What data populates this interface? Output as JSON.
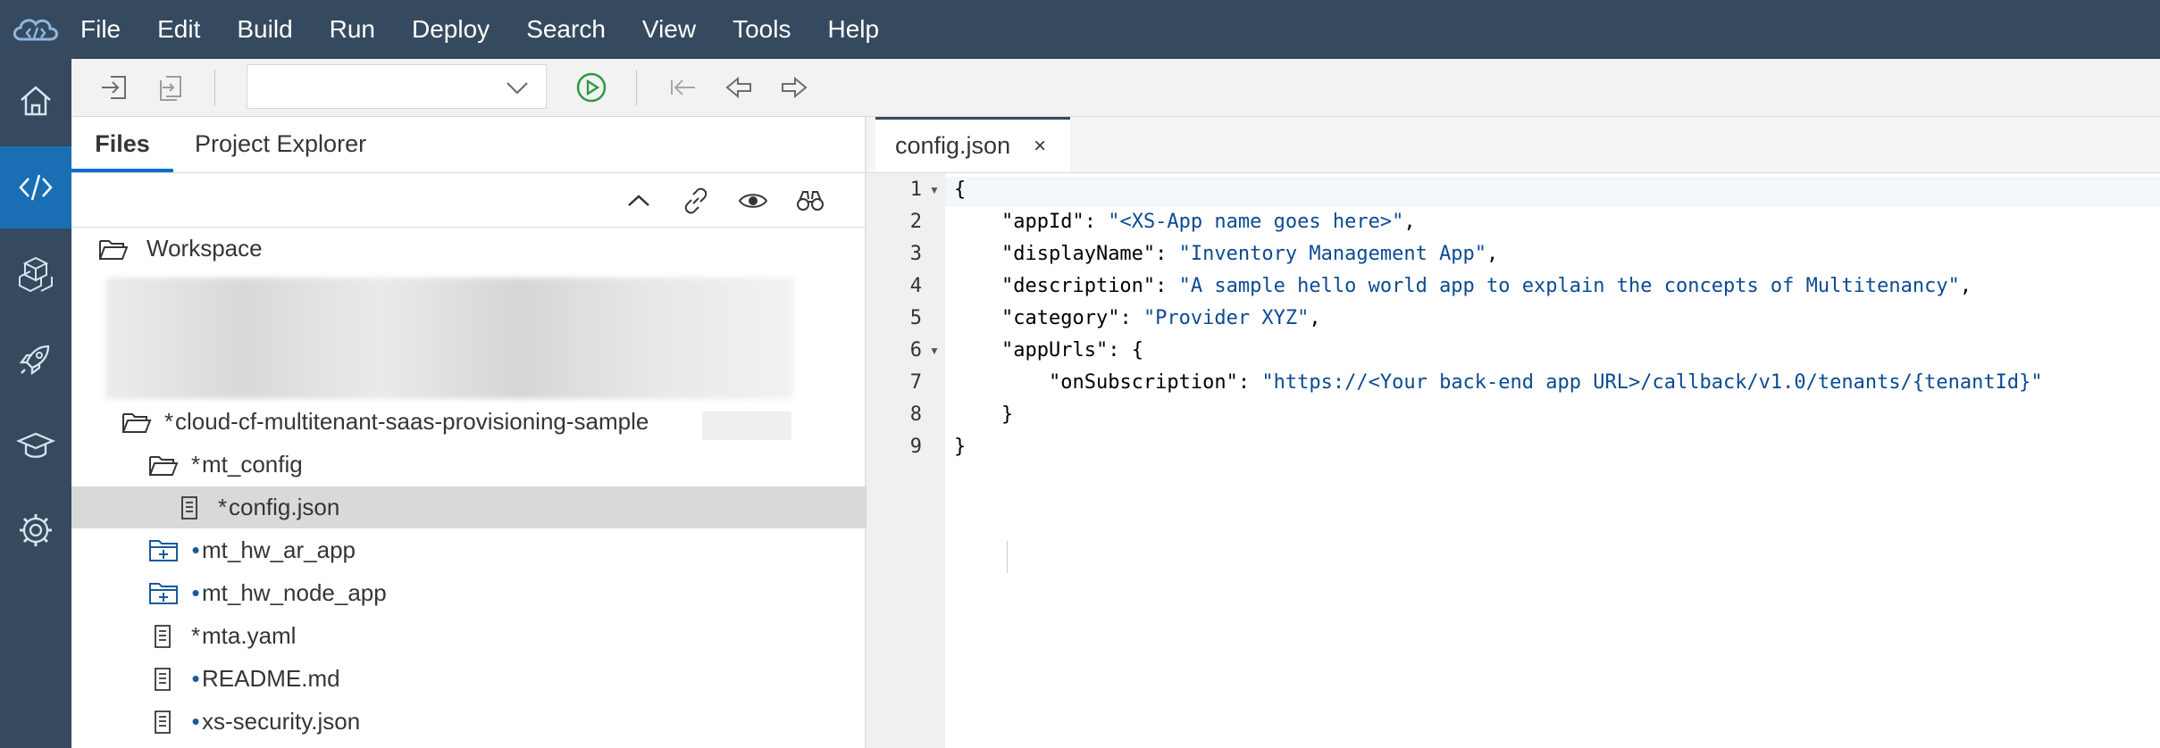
{
  "menu": [
    "File",
    "Edit",
    "Build",
    "Run",
    "Deploy",
    "Search",
    "View",
    "Tools",
    "Help"
  ],
  "left_tabs": {
    "files": "Files",
    "explorer": "Project Explorer"
  },
  "tree": [
    {
      "label": "Workspace",
      "mark": "",
      "type": "folder-open"
    },
    {
      "label": "cloud-cf-multitenant-saas-provisioning-sample",
      "mark": "*",
      "type": "folder-open"
    },
    {
      "label": "mt_config",
      "mark": "*",
      "type": "folder-open"
    },
    {
      "label": "config.json",
      "mark": "*",
      "type": "file"
    },
    {
      "label": "mt_hw_ar_app",
      "mark": "•",
      "type": "folder-module"
    },
    {
      "label": "mt_hw_node_app",
      "mark": "•",
      "type": "folder-module"
    },
    {
      "label": "mta.yaml",
      "mark": "*",
      "type": "file"
    },
    {
      "label": "README.md",
      "mark": "•",
      "type": "file"
    },
    {
      "label": "xs-security.json",
      "mark": "•",
      "type": "file"
    }
  ],
  "editor": {
    "tab_label": "config.json",
    "close_glyph": "×",
    "line_numbers": [
      "1",
      "2",
      "3",
      "4",
      "5",
      "6",
      "7",
      "8",
      "9"
    ],
    "lines": [
      "{",
      "    \"appId\": \"<XS-App name goes here>\",",
      "    \"displayName\": \"Inventory Management App\",",
      "    \"description\": \"A sample hello world app to explain the concepts of Multitenancy\",",
      "    \"category\": \"Provider XYZ\",",
      "    \"appUrls\": {",
      "        \"onSubscription\": \"https://<Your back-end app URL>/callback/v1.0/tenants/{tenantId}\"",
      "    }",
      "}"
    ]
  },
  "colors": {
    "shell": "#354a5f",
    "active": "#1a6fb4",
    "string": "#0b4a92"
  }
}
